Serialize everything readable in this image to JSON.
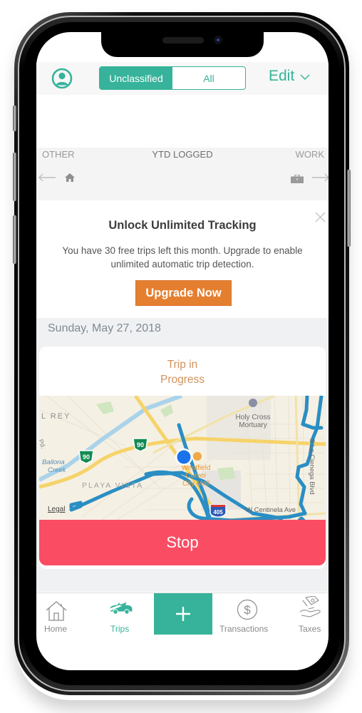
{
  "header": {
    "profile_icon": "user-circle-icon",
    "segments": [
      {
        "label": "Unclassified",
        "active": true
      },
      {
        "label": "All",
        "active": false
      }
    ],
    "edit_label": "Edit",
    "edit_icon": "chevron-down-icon"
  },
  "ytd": {
    "left_label": "OTHER",
    "title": "YTD LOGGED",
    "right_label": "WORK",
    "left_icon": "home-icon",
    "right_icon": "briefcase-icon"
  },
  "promo": {
    "title": "Unlock Unlimited Tracking",
    "text": "You have 30 free trips left this month. Upgrade to enable unlimited automatic trip detection.",
    "button_label": "Upgrade Now",
    "close_icon": "close-icon"
  },
  "trips": {
    "date": "Sunday, May 27, 2018",
    "trip": {
      "status": "Trip in Progress",
      "status_lines": [
        "Trip in",
        "Progress"
      ],
      "stop_label": "Stop",
      "map": {
        "labels": {
          "marina": "L REY",
          "creek_line1": "Ballona",
          "creek_line2": "Creek",
          "playa": "PLAYA VISTA",
          "holy_cross_line1": "Holy Cross",
          "holy_cross_line2": "Mortuary",
          "mall_line1": "Westfield",
          "mall_line2": "Culver",
          "mall_line3": "City Mall",
          "cienega": "S La Cienega Blvd",
          "centinela": "W Centinela Ave",
          "route_90": "90",
          "route_405": "405",
          "legal": "Legal",
          "blvd_stub": "Pd."
        }
      }
    }
  },
  "tabbar": {
    "items": [
      {
        "label": "Home",
        "icon": "house-icon",
        "active": false
      },
      {
        "label": "Trips",
        "icon": "car-icon",
        "active": true
      },
      {
        "label": "",
        "icon": "plus-icon",
        "active": false
      },
      {
        "label": "Transactions",
        "icon": "dollar-circle-icon",
        "active": false
      },
      {
        "label": "Taxes",
        "icon": "hand-money-icon",
        "active": false
      }
    ]
  },
  "colors": {
    "accent": "#36b39a",
    "upgrade": "#e57f30",
    "stop": "#fa4d63",
    "trip_status": "#d1925b",
    "route": "#2a8ec4"
  }
}
